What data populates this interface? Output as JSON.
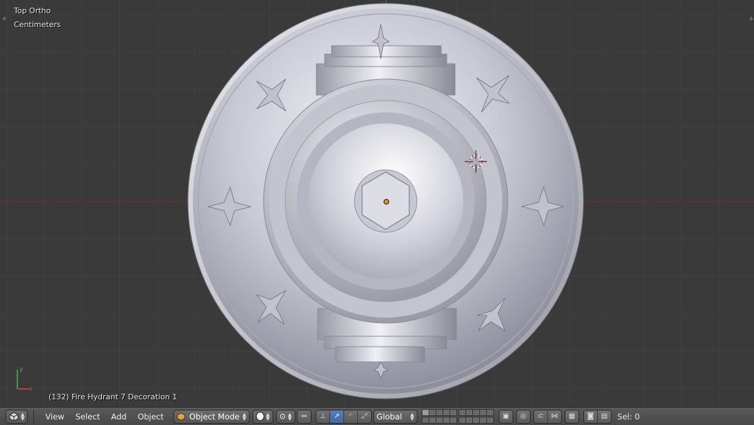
{
  "viewport": {
    "view_name": "Top Ortho",
    "units": "Centimeters",
    "object_info": "(132) Fire Hydrant 7 Decoration 1",
    "axis_label_y": "y",
    "axis_label_x": "x",
    "colors": {
      "background": "#393939",
      "x_axis": "#7a2a2a",
      "y_axis": "#3c7a3c",
      "origin": "#f08a24"
    }
  },
  "header": {
    "menus": [
      "View",
      "Select",
      "Add",
      "Object"
    ],
    "mode": "Object Mode",
    "orientation": "Global",
    "selection": "Sel: 0",
    "icons": {
      "editor_type": "cube-icon",
      "shading": "solid-sphere-icon",
      "pivot": "pivot-icon",
      "manipulator": "manipulator-icon",
      "snap": "magnet-icon",
      "render": "camera-icon"
    }
  }
}
